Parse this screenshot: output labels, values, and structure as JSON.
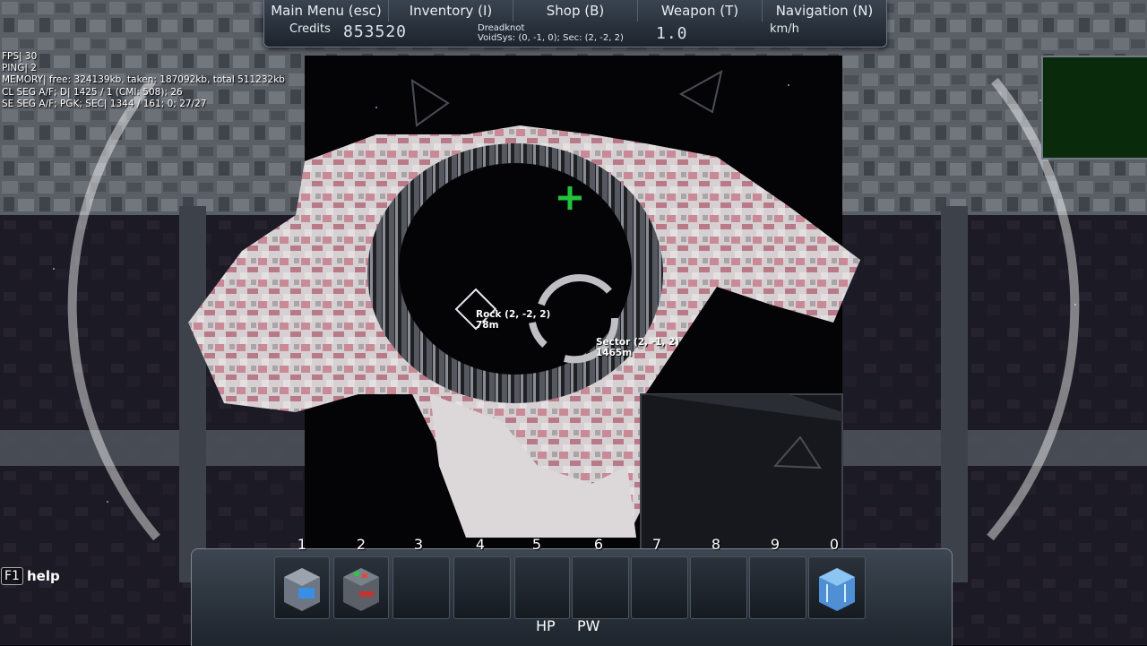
{
  "menu": [
    {
      "label": "Main Menu (esc)",
      "name": "main-menu-button"
    },
    {
      "label": "Inventory (I)",
      "name": "inventory-button"
    },
    {
      "label": "Shop (B)",
      "name": "shop-button"
    },
    {
      "label": "Weapon (T)",
      "name": "weapon-button"
    },
    {
      "label": "Navigation (N)",
      "name": "navigation-button"
    }
  ],
  "info": {
    "credits_label": "Credits",
    "credits_value": "853520",
    "ship_name": "Dreadknot",
    "location": "VoidSys: (0, -1, 0); Sec: (2, -2, 2)",
    "speed_value": "1.0",
    "speed_unit": "km/h"
  },
  "debug": [
    "FPS| 30",
    "PING| 2",
    "MEMORY| free: 324139kb, taken: 187092kb, total 511232kb",
    "CL SEG A/F; D| 1425 / 1 (CMI: 508); 26",
    "SE SEG A/F; PGK; SEC| 1344 / 161; 0; 27/27"
  ],
  "nav_markers": {
    "rock_name": "Rock (2, -2, 2)",
    "rock_dist": "78m",
    "sector_name": "Sector (2, -1, 2)",
    "sector_dist": "1465m"
  },
  "help": {
    "key": "F1",
    "label": "help"
  },
  "hotbar": {
    "slots": [
      "1",
      "2",
      "3",
      "4",
      "5",
      "6",
      "7",
      "8",
      "9",
      "0"
    ],
    "hp_label": "HP",
    "pw_label": "PW",
    "hp_fraction": 0.78,
    "pw_fraction": 0.0
  },
  "colors": {
    "asteroid": "#d9c3c8",
    "asteroid_pink": "#c98a98",
    "hp_green": "#27c13a",
    "shield_purple": "#8a8ad8",
    "power_blue": "#1a1ad8",
    "radar_green": "#0a2a0c",
    "crosshair_green": "#22c23a"
  }
}
